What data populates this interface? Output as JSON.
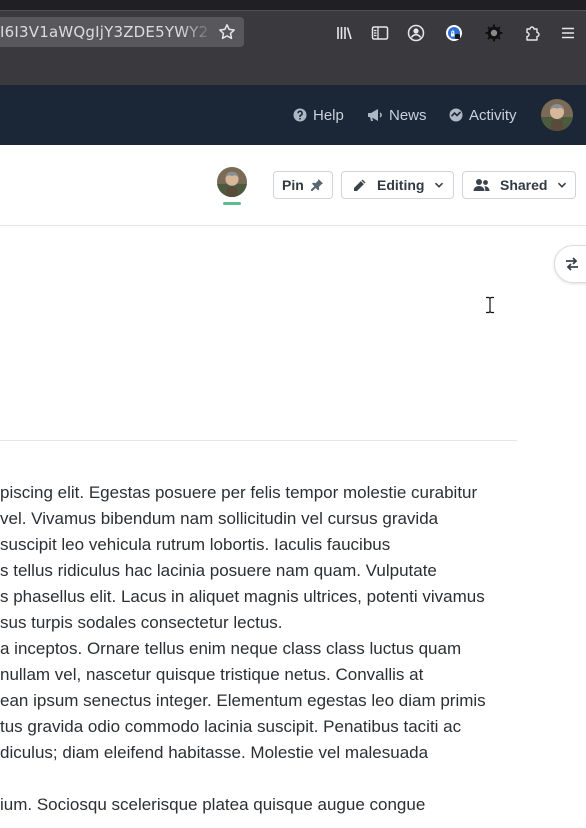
{
  "browser": {
    "url_text": "I6I3V1aWQgIjY3ZDE5YWY2",
    "icons": [
      "bookmark-star-icon",
      "library-icon",
      "sidebar-icon",
      "account-icon",
      "extension-lock-icon",
      "extension-gear-icon",
      "extensions-icon",
      "menu-icon"
    ]
  },
  "header": {
    "help_label": "Help",
    "news_label": "News",
    "activity_label": "Activity"
  },
  "toolbar": {
    "pin_label": "Pin",
    "editing_label": "Editing",
    "shared_label": "Shared",
    "presence_color": "#5dbb8f"
  },
  "document": {
    "paragraph1": [
      "piscing elit. Egestas posuere per felis tempor molestie curabitur",
      "vel. Vivamus bibendum nam sollicitudin vel cursus gravida",
      "suscipit leo vehicula rutrum lobortis. Iaculis faucibus",
      "s tellus ridiculus hac lacinia posuere nam quam. Vulputate",
      "s phasellus elit. Lacus in aliquet magnis ultrices, potenti vivamus",
      "sus turpis sodales consectetur lectus.",
      "a inceptos. Ornare tellus enim neque class class luctus quam",
      "nullam vel, nascetur quisque tristique netus. Convallis at",
      "ean ipsum senectus integer. Elementum egestas leo diam primis",
      "tus gravida odio commodo lacinia suscipit. Penatibus taciti ac",
      "diculus; diam eleifend habitasse. Molestie vel malesuada"
    ],
    "paragraph2": [
      "ium. Sociosqu scelerisque platea quisque augue congue"
    ]
  }
}
